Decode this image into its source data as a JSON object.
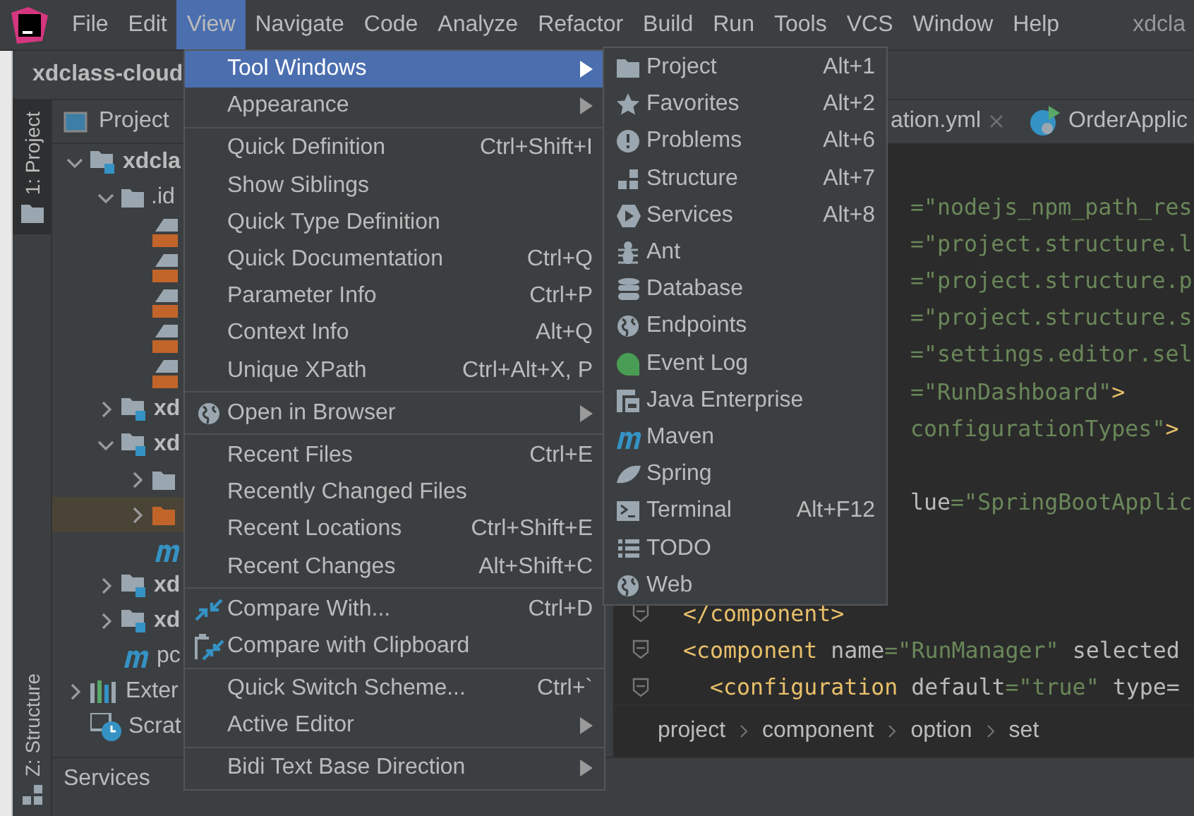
{
  "menu_bar": {
    "items": [
      {
        "label": "File",
        "selected": false
      },
      {
        "label": "Edit",
        "selected": false
      },
      {
        "label": "View",
        "selected": true
      },
      {
        "label": "Navigate",
        "selected": false
      },
      {
        "label": "Code",
        "selected": false
      },
      {
        "label": "Analyze",
        "selected": false
      },
      {
        "label": "Refactor",
        "selected": false
      },
      {
        "label": "Build",
        "selected": false
      },
      {
        "label": "Run",
        "selected": false
      },
      {
        "label": "Tools",
        "selected": false
      },
      {
        "label": "VCS",
        "selected": false
      },
      {
        "label": "Window",
        "selected": false
      },
      {
        "label": "Help",
        "selected": false
      }
    ],
    "title": "xdcla"
  },
  "nav_bar": {
    "project": "xdclass-cloud"
  },
  "tool_stripe": [
    {
      "label": "1: Project",
      "selected": true,
      "kind": "top"
    },
    {
      "label": "Z: Structure",
      "selected": false,
      "kind": "bottom"
    }
  ],
  "project_panel": {
    "title": "Project",
    "tree": [
      {
        "label": "xdcla",
        "kind": "module",
        "expanded": true,
        "selected": false,
        "children": [
          {
            "label": ".id",
            "kind": "folder",
            "expanded": true,
            "selected": false,
            "children": [
              {
                "kind": "xml",
                "selected": false
              },
              {
                "kind": "xml",
                "selected": false
              },
              {
                "kind": "xml",
                "selected": false
              },
              {
                "kind": "xml",
                "selected": false
              },
              {
                "kind": "xml",
                "selected": false
              }
            ]
          },
          {
            "label": "xd",
            "kind": "module",
            "expanded": false,
            "selected": false
          },
          {
            "label": "xd",
            "kind": "module",
            "expanded": true,
            "selected": false,
            "children": [
              {
                "kind": "folder",
                "expanded": false,
                "selected": false
              },
              {
                "kind": "excluded",
                "expanded": false,
                "selected": true
              },
              {
                "kind": "maven",
                "selected": false
              }
            ]
          },
          {
            "label": "xd",
            "kind": "module",
            "expanded": false,
            "selected": false
          },
          {
            "label": "xd",
            "kind": "module",
            "expanded": false,
            "selected": false
          },
          {
            "label": "pc",
            "kind": "maven",
            "selected": false
          }
        ]
      },
      {
        "label": "Exter",
        "kind": "library",
        "expanded": false,
        "selected": false
      },
      {
        "label": "Scrat",
        "kind": "scratch",
        "selected": false
      }
    ]
  },
  "editor": {
    "tabs": [
      {
        "label": "ation.yml",
        "kind": "file",
        "closable": true
      },
      {
        "label": "OrderApplic",
        "kind": "app"
      }
    ],
    "lines": [
      {
        "kind": "clipped",
        "tokens": [
          {
            "kind": "value",
            "text": "=\"nodejs_npm_path_res"
          }
        ]
      },
      {
        "kind": "clipped",
        "tokens": [
          {
            "kind": "value",
            "text": "=\"project.structure.l"
          }
        ]
      },
      {
        "kind": "clipped",
        "tokens": [
          {
            "kind": "value",
            "text": "=\"project.structure.p"
          }
        ]
      },
      {
        "kind": "clipped",
        "tokens": [
          {
            "kind": "value",
            "text": "=\"project.structure.s"
          }
        ]
      },
      {
        "kind": "clipped",
        "tokens": [
          {
            "kind": "value",
            "text": "=\"settings.editor.sel"
          }
        ]
      },
      {
        "kind": "clipped",
        "tokens": [
          {
            "kind": "value",
            "text": "=\"RunDashboard\""
          },
          {
            "kind": "tag",
            "text": ">"
          }
        ]
      },
      {
        "kind": "clipped",
        "tokens": [
          {
            "kind": "value",
            "text": "configurationTypes\""
          },
          {
            "kind": "tag",
            "text": ">"
          }
        ]
      },
      {
        "kind": "empty"
      },
      {
        "kind": "clipped",
        "tokens": [
          {
            "kind": "attr",
            "text": "lue"
          },
          {
            "kind": "value",
            "text": "=\"SpringBootApplic"
          }
        ]
      },
      {
        "kind": "empty"
      },
      {
        "kind": "empty"
      },
      {
        "kind": "outer",
        "tokens": [
          {
            "kind": "tag",
            "text": "</component>"
          }
        ]
      },
      {
        "kind": "outer",
        "tokens": [
          {
            "kind": "tag",
            "text": "<component "
          },
          {
            "kind": "attr",
            "text": "name"
          },
          {
            "kind": "value",
            "text": "=\"RunManager\" "
          },
          {
            "kind": "attr",
            "text": "selected"
          }
        ]
      },
      {
        "kind": "inner",
        "tokens": [
          {
            "kind": "tag",
            "text": "<configuration "
          },
          {
            "kind": "attr",
            "text": "default"
          },
          {
            "kind": "value",
            "text": "=\"true\" "
          },
          {
            "kind": "attr",
            "text": "type="
          }
        ]
      }
    ],
    "breadcrumb": [
      "project",
      "component",
      "option",
      "set"
    ]
  },
  "view_menu": {
    "groups": [
      [
        {
          "label": "Tool Windows",
          "submenu": true,
          "selected": true,
          "kind": "plain"
        },
        {
          "label": "Appearance",
          "submenu": true,
          "selected": false,
          "kind": "plain"
        }
      ],
      [
        {
          "label": "Quick Definition",
          "shortcut": "Ctrl+Shift+I",
          "submenu": false,
          "selected": false,
          "kind": "plain"
        },
        {
          "label": "Show Siblings",
          "submenu": false,
          "selected": false,
          "kind": "plain"
        },
        {
          "label": "Quick Type Definition",
          "submenu": false,
          "selected": false,
          "kind": "plain"
        },
        {
          "label": "Quick Documentation",
          "shortcut": "Ctrl+Q",
          "submenu": false,
          "selected": false,
          "kind": "plain"
        },
        {
          "label": "Parameter Info",
          "shortcut": "Ctrl+P",
          "submenu": false,
          "selected": false,
          "kind": "plain"
        },
        {
          "label": "Context Info",
          "shortcut": "Alt+Q",
          "submenu": false,
          "selected": false,
          "kind": "plain"
        },
        {
          "label": "Unique XPath",
          "shortcut": "Ctrl+Alt+X, P",
          "submenu": false,
          "selected": false,
          "kind": "plain"
        }
      ],
      [
        {
          "label": "Open in Browser",
          "submenu": true,
          "selected": false,
          "kind": "globe"
        }
      ],
      [
        {
          "label": "Recent Files",
          "shortcut": "Ctrl+E",
          "submenu": false,
          "selected": false,
          "kind": "plain"
        },
        {
          "label": "Recently Changed Files",
          "submenu": false,
          "selected": false,
          "kind": "plain"
        },
        {
          "label": "Recent Locations",
          "shortcut": "Ctrl+Shift+E",
          "submenu": false,
          "selected": false,
          "kind": "plain"
        },
        {
          "label": "Recent Changes",
          "shortcut": "Alt+Shift+C",
          "submenu": false,
          "selected": false,
          "kind": "plain"
        }
      ],
      [
        {
          "label": "Compare With...",
          "shortcut": "Ctrl+D",
          "submenu": false,
          "selected": false,
          "kind": "compare"
        },
        {
          "label": "Compare with Clipboard",
          "submenu": false,
          "selected": false,
          "kind": "clipboard-compare"
        }
      ],
      [
        {
          "label": "Quick Switch Scheme...",
          "shortcut": "Ctrl+`",
          "submenu": false,
          "selected": false,
          "kind": "plain"
        },
        {
          "label": "Active Editor",
          "submenu": true,
          "selected": false,
          "kind": "plain"
        }
      ],
      [
        {
          "label": "Bidi Text Base Direction",
          "submenu": true,
          "selected": false,
          "kind": "plain"
        }
      ]
    ]
  },
  "tool_windows_menu": {
    "items": [
      {
        "label": "Project",
        "shortcut": "Alt+1",
        "kind": "folder"
      },
      {
        "label": "Favorites",
        "shortcut": "Alt+2",
        "kind": "star"
      },
      {
        "label": "Problems",
        "shortcut": "Alt+6",
        "kind": "exclamation"
      },
      {
        "label": "Structure",
        "shortcut": "Alt+7",
        "kind": "structure"
      },
      {
        "label": "Services",
        "shortcut": "Alt+8",
        "kind": "services"
      },
      {
        "label": "Ant",
        "kind": "ant"
      },
      {
        "label": "Database",
        "kind": "database"
      },
      {
        "label": "Endpoints",
        "kind": "globe"
      },
      {
        "label": "Event Log",
        "kind": "event-log"
      },
      {
        "label": "Java Enterprise",
        "kind": "enterprise"
      },
      {
        "label": "Maven",
        "kind": "maven"
      },
      {
        "label": "Spring",
        "kind": "leaf"
      },
      {
        "label": "Terminal",
        "shortcut": "Alt+F12",
        "kind": "terminal"
      },
      {
        "label": "TODO",
        "kind": "list"
      },
      {
        "label": "Web",
        "kind": "globe"
      }
    ]
  },
  "services_panel": {
    "title": "Services"
  }
}
